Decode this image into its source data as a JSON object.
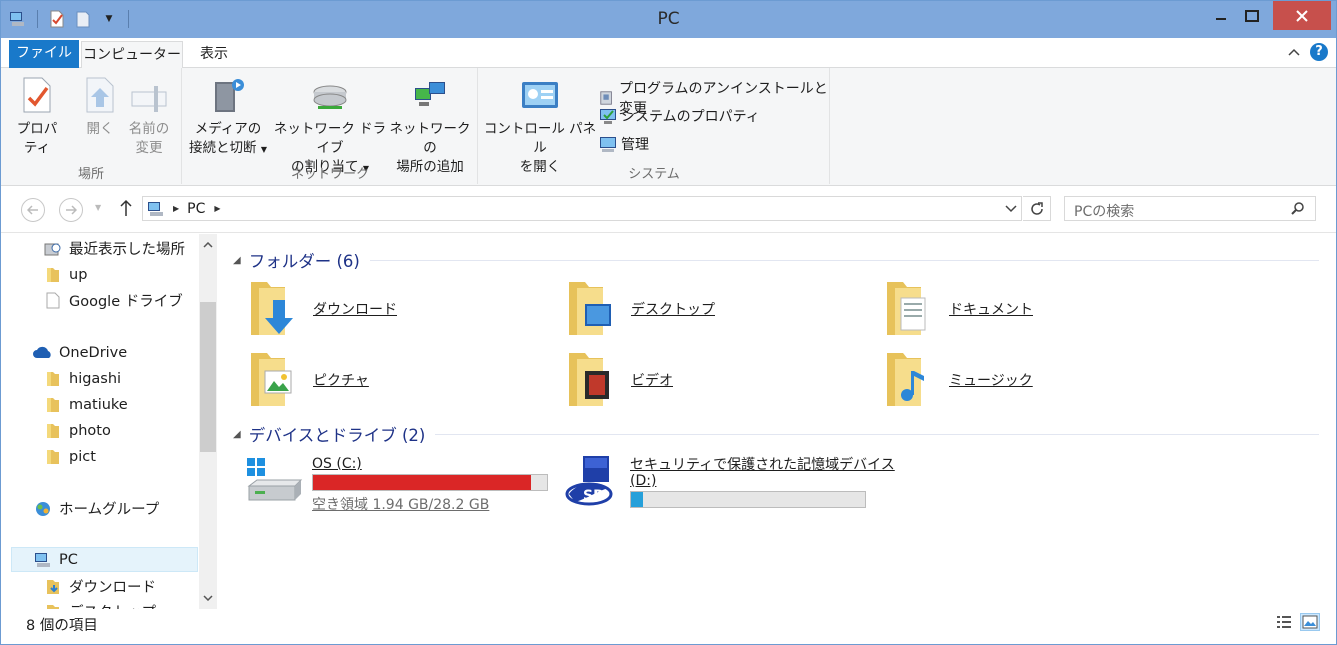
{
  "window": {
    "title": "PC"
  },
  "quick_access": {
    "icons": [
      "computer-icon",
      "properties-icon",
      "new-folder-icon",
      "customize-dropdown-icon"
    ]
  },
  "tabs": [
    {
      "label": "ファイル",
      "active": false
    },
    {
      "label": "コンピューター",
      "active": true
    },
    {
      "label": "表示",
      "active": false
    }
  ],
  "ribbon": {
    "groups": {
      "location": "場所",
      "network": "ネットワーク",
      "system": "システム"
    },
    "buttons": {
      "properties": "プロパティ",
      "open": "開く",
      "rename_1": "名前の",
      "rename_2": "変更",
      "media_1": "メディアの",
      "media_2": "接続と切断",
      "netdrive_1": "ネットワーク ドライブ",
      "netdrive_2": "の割り当て",
      "netloc_1": "ネットワークの",
      "netloc_2": "場所の追加",
      "control_1": "コントロール パネル",
      "control_2": "を開く",
      "uninstall": "プログラムのアンインストールと変更",
      "sysprops": "システムのプロパティ",
      "manage": "管理"
    }
  },
  "address": {
    "path": "PC",
    "search_placeholder": "PCの検索"
  },
  "nav": {
    "items": [
      {
        "label": "最近表示した場所"
      },
      {
        "label": "up"
      },
      {
        "label": "Google ドライブ"
      },
      {
        "label": "OneDrive"
      },
      {
        "label": "higashi"
      },
      {
        "label": "matiuke"
      },
      {
        "label": "photo"
      },
      {
        "label": "pict"
      },
      {
        "label": "ホームグループ"
      },
      {
        "label": "PC"
      },
      {
        "label": "ダウンロード"
      },
      {
        "label": "デスクトップ"
      }
    ]
  },
  "content": {
    "folders_header": "フォルダー (6)",
    "folders": [
      {
        "label": "ダウンロード"
      },
      {
        "label": "デスクトップ"
      },
      {
        "label": "ドキュメント"
      },
      {
        "label": "ピクチャ"
      },
      {
        "label": "ビデオ"
      },
      {
        "label": "ミュージック"
      }
    ],
    "drives_header": "デバイスとドライブ (2)",
    "drives": [
      {
        "label": "OS (C:)",
        "free": "空き領域 1.94 GB/28.2 GB",
        "used_fraction": 0.93,
        "bar_color": "#da2626"
      },
      {
        "label_1": "セキュリティで保護された記憶域デバイス",
        "label_2": "(D:)",
        "used_fraction": 0.05,
        "bar_color": "#26a0da"
      }
    ]
  },
  "status": {
    "items": "8 個の項目"
  },
  "colors": {
    "titlebar": "#7fa8dc",
    "file_tab": "#1979ca",
    "close": "#c7504c",
    "header_text": "#1e3287"
  }
}
